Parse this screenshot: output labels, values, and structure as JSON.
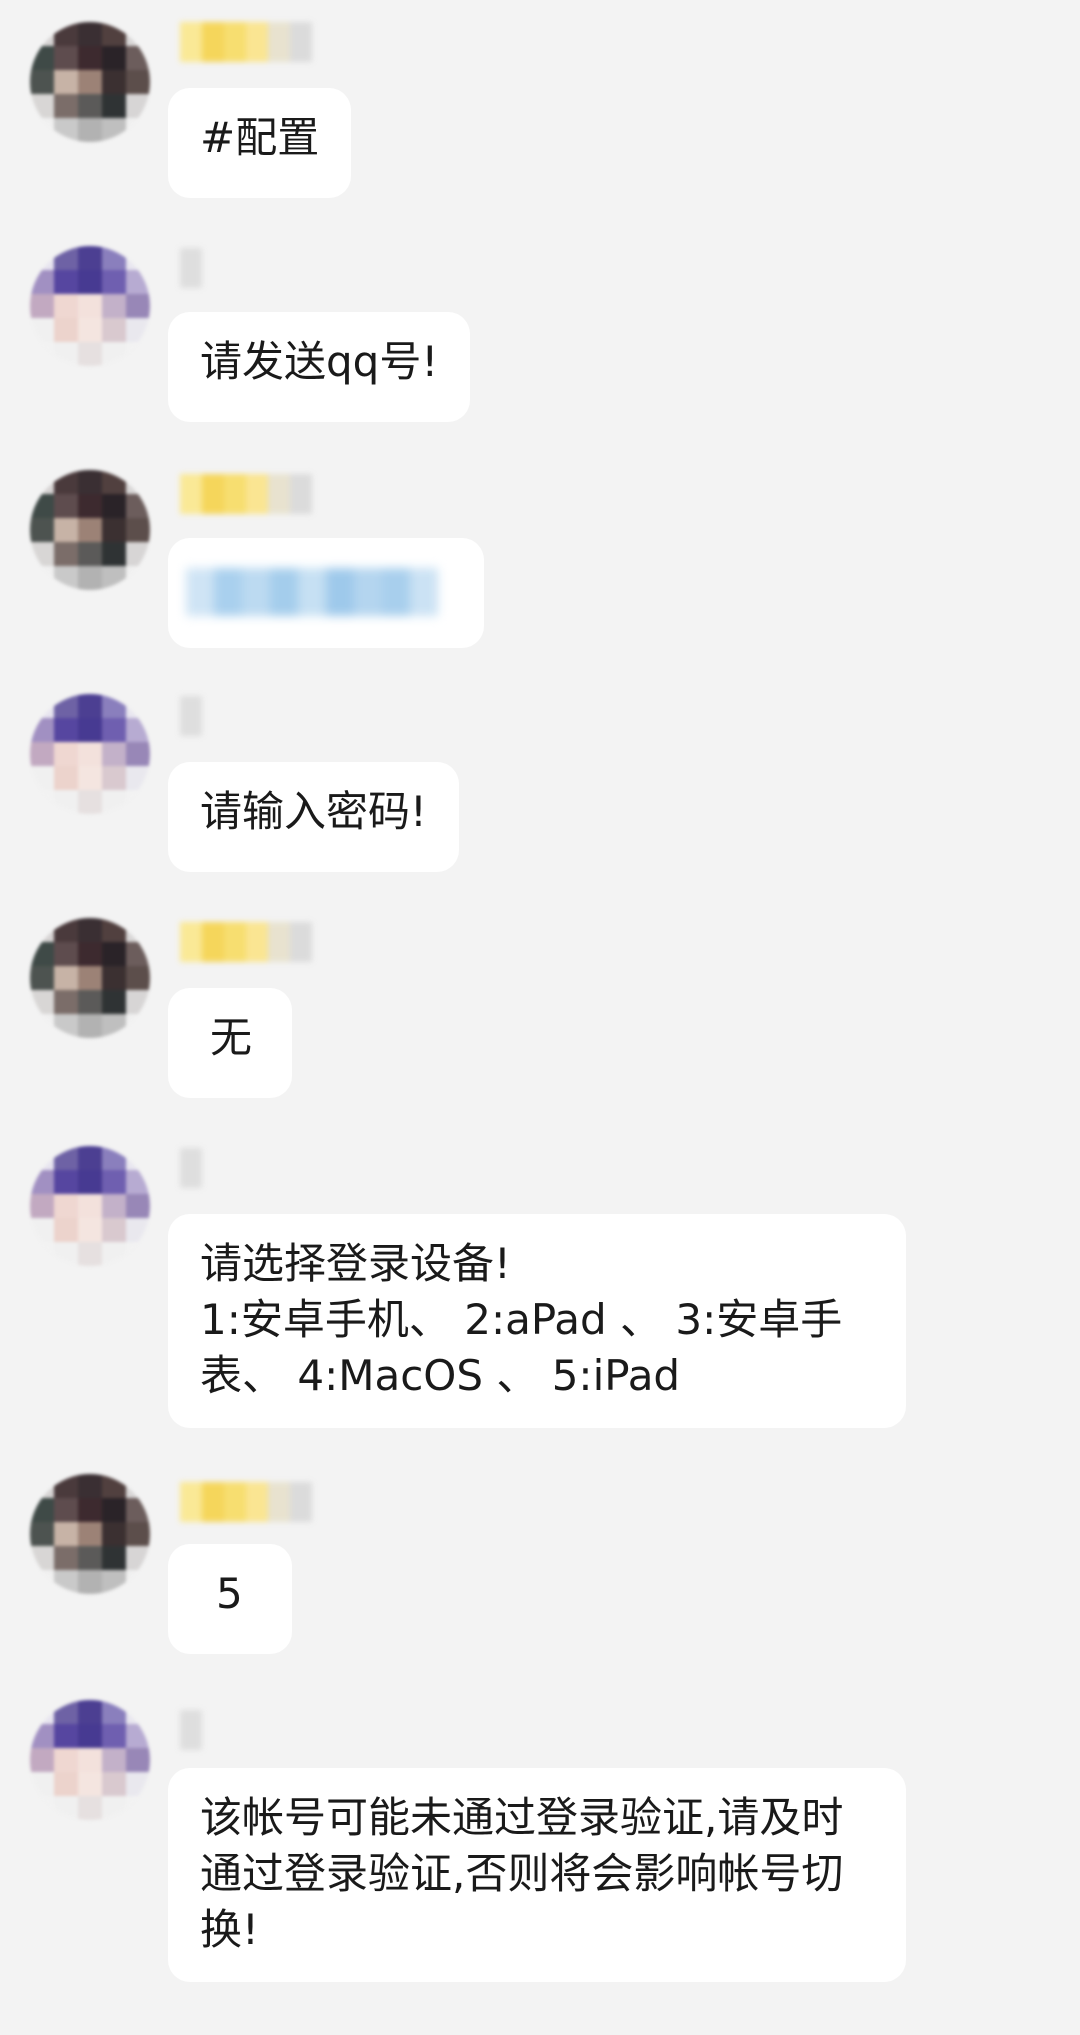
{
  "messages": [
    {
      "sender": "user",
      "text": "#配置"
    },
    {
      "sender": "bot",
      "text": "请发送qq号!"
    },
    {
      "sender": "user",
      "text": ""
    },
    {
      "sender": "bot",
      "text": "请输入密码!"
    },
    {
      "sender": "user",
      "text": "无"
    },
    {
      "sender": "bot",
      "text": "请选择登录设备!\n1:安卓手机、 2:aPad 、 3:安卓手表、 4:MacOS 、 5:iPad"
    },
    {
      "sender": "user",
      "text": "5"
    },
    {
      "sender": "bot",
      "text": "该帐号可能未通过登录验证,请及时通过登录验证,否则将会影响帐号切换!"
    }
  ],
  "colors": {
    "background": "#f3f3f3",
    "bubble": "#ffffff",
    "text": "#1a1a1a",
    "user_nick": "#f7d65a",
    "bot_avatar": "#5a4a9a",
    "blurred_text": "#a9d0ee"
  }
}
